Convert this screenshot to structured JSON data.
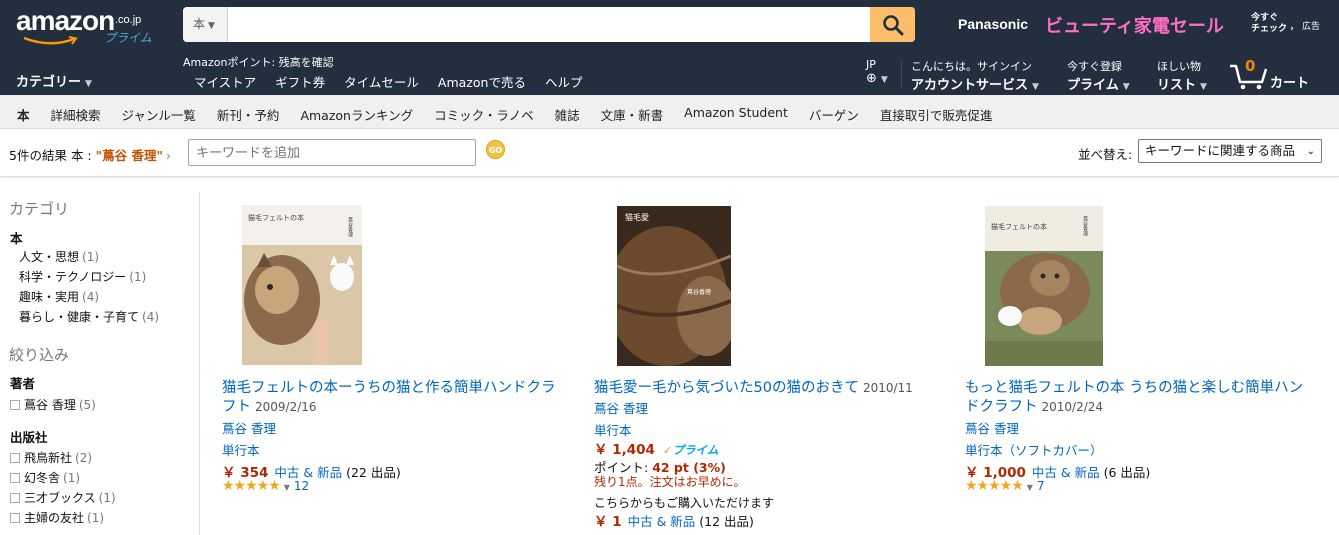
{
  "header": {
    "logo": {
      "word": "amazon",
      "tld": ".co.jp",
      "prime": "プライム"
    },
    "search": {
      "department": "本",
      "value": "",
      "placeholder": ""
    },
    "promo": {
      "brand": "Panasonic",
      "sale": "ビューティ家電セール",
      "check_line1": "今すぐ",
      "check_line2": "チェック",
      "ad": "広告"
    },
    "category_menu": "カテゴリー",
    "points": "Amazonポイント: 残高を確認",
    "links": [
      "マイストア",
      "ギフト券",
      "タイムセール",
      "Amazonで売る",
      "ヘルプ"
    ],
    "lang": "JP",
    "account": {
      "line1": "こんにちは。サインイン",
      "line2": "アカウントサービス"
    },
    "prime": {
      "line1": "今すぐ登録",
      "line2": "プライム"
    },
    "wishlist": {
      "line1": "ほしい物",
      "line2": "リスト"
    },
    "cart": {
      "count": "0",
      "label": "カート"
    }
  },
  "subnav": [
    "本",
    "詳細検索",
    "ジャンル一覧",
    "新刊・予約",
    "Amazonランキング",
    "コミック・ラノベ",
    "雑誌",
    "文庫・新書",
    "Amazon Student",
    "バーゲン",
    "直接取引で販売促進"
  ],
  "results_bar": {
    "count": "5件の結果",
    "scope": "本 : ",
    "query": "\"蔦谷 香理\"",
    "keyword_placeholder": "キーワードを追加",
    "go": "GO",
    "sort_label": "並べ替え:",
    "sort_value": "キーワードに関連する商品"
  },
  "leftnav": {
    "category_heading": "カテゴリ",
    "root": "本",
    "categories": [
      {
        "label": "人文・思想",
        "count": "(1)"
      },
      {
        "label": "科学・テクノロジー",
        "count": "(1)"
      },
      {
        "label": "趣味・実用",
        "count": "(4)"
      },
      {
        "label": "暮らし・健康・子育て",
        "count": "(4)"
      }
    ],
    "refine_heading": "絞り込み",
    "author_heading": "著者",
    "authors": [
      {
        "label": "蔦谷 香理",
        "count": "(5)"
      }
    ],
    "publisher_heading": "出版社",
    "publishers": [
      {
        "label": "飛鳥新社",
        "count": "(2)"
      },
      {
        "label": "幻冬舎",
        "count": "(1)"
      },
      {
        "label": "三才ブックス",
        "count": "(1)"
      },
      {
        "label": "主婦の友社",
        "count": "(1)"
      }
    ]
  },
  "results": [
    {
      "cover_title": "猫毛フェルトの本",
      "cover_author": "蔦谷香理",
      "title_line1": "猫毛フェルトの本ーうちの猫と作る簡単ハンドクラ",
      "title_line2": "フト",
      "date": "2009/2/16",
      "author": "蔦谷 香理",
      "format": "単行本",
      "price": "￥ 354",
      "offers_link": "中古 & 新品",
      "offers_count": "(22 出品)",
      "rating": 5,
      "reviews": "12"
    },
    {
      "cover_title": "猫毛愛",
      "cover_author": "蔦谷香理",
      "title_line1": "猫毛愛ー毛から気づいた50の猫のおきて",
      "date": "2010/11",
      "author": "蔦谷 香理",
      "format": "単行本",
      "price": "￥ 1,404",
      "prime": "プライム",
      "points_label": "ポイント: ",
      "points_value": "42 pt (3%)",
      "stock": "残り1点。注文はお早めに。",
      "other_label": "こちらからもご購入いただけます",
      "other_price": "￥ 1",
      "other_link": "中古 & 新品",
      "other_count": "(12 出品)"
    },
    {
      "cover_title": "猫毛フェルトの本",
      "cover_author": "蔦谷香理",
      "title_line1": "もっと猫毛フェルトの本 うちの猫と楽しむ簡単ハン",
      "title_line2": "ドクラフト",
      "date": "2010/2/24",
      "author": "蔦谷 香理",
      "format": "単行本（ソフトカバー）",
      "price": "￥ 1,000",
      "offers_link": "中古 & 新品",
      "offers_count": "(6 出品)",
      "rating": 5,
      "reviews": "7"
    }
  ],
  "colors": {
    "nav": "#232f3e",
    "search_button": "#febd69",
    "link": "#0066c0",
    "price": "#b12704",
    "query": "#c45500"
  }
}
